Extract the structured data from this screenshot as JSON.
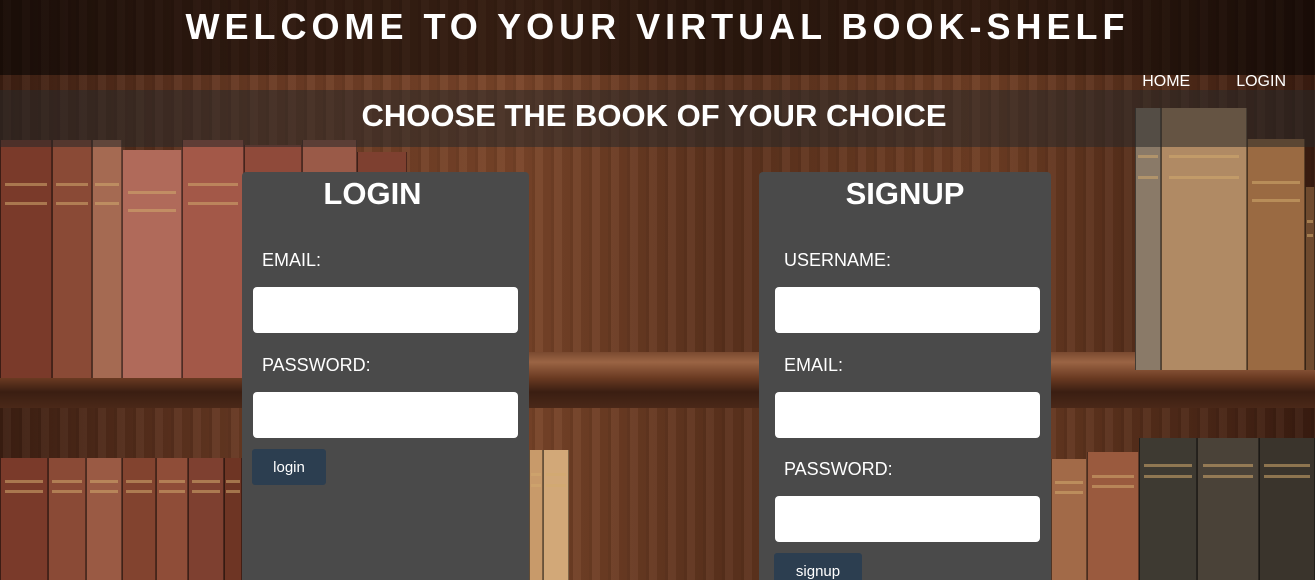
{
  "header": {
    "title": "WELCOME TO YOUR VIRTUAL BOOK-SHELF"
  },
  "nav": {
    "items": [
      {
        "label": "HOME"
      },
      {
        "label": "LOGIN"
      }
    ]
  },
  "banner": {
    "title": "CHOOSE THE BOOK OF YOUR CHOICE"
  },
  "login": {
    "title": "LOGIN",
    "email_label": "EMAIL:",
    "email_value": "",
    "password_label": "PASSWORD:",
    "password_value": "",
    "button_label": "login"
  },
  "signup": {
    "title": "SIGNUP",
    "username_label": "USERNAME:",
    "username_value": "",
    "email_label": "EMAIL:",
    "email_value": "",
    "password_label": "PASSWORD:",
    "password_value": "",
    "button_label": "signup"
  },
  "colors": {
    "panel_bg": "#4a4a4a",
    "button_bg": "#2c3e50",
    "text": "#ffffff"
  }
}
